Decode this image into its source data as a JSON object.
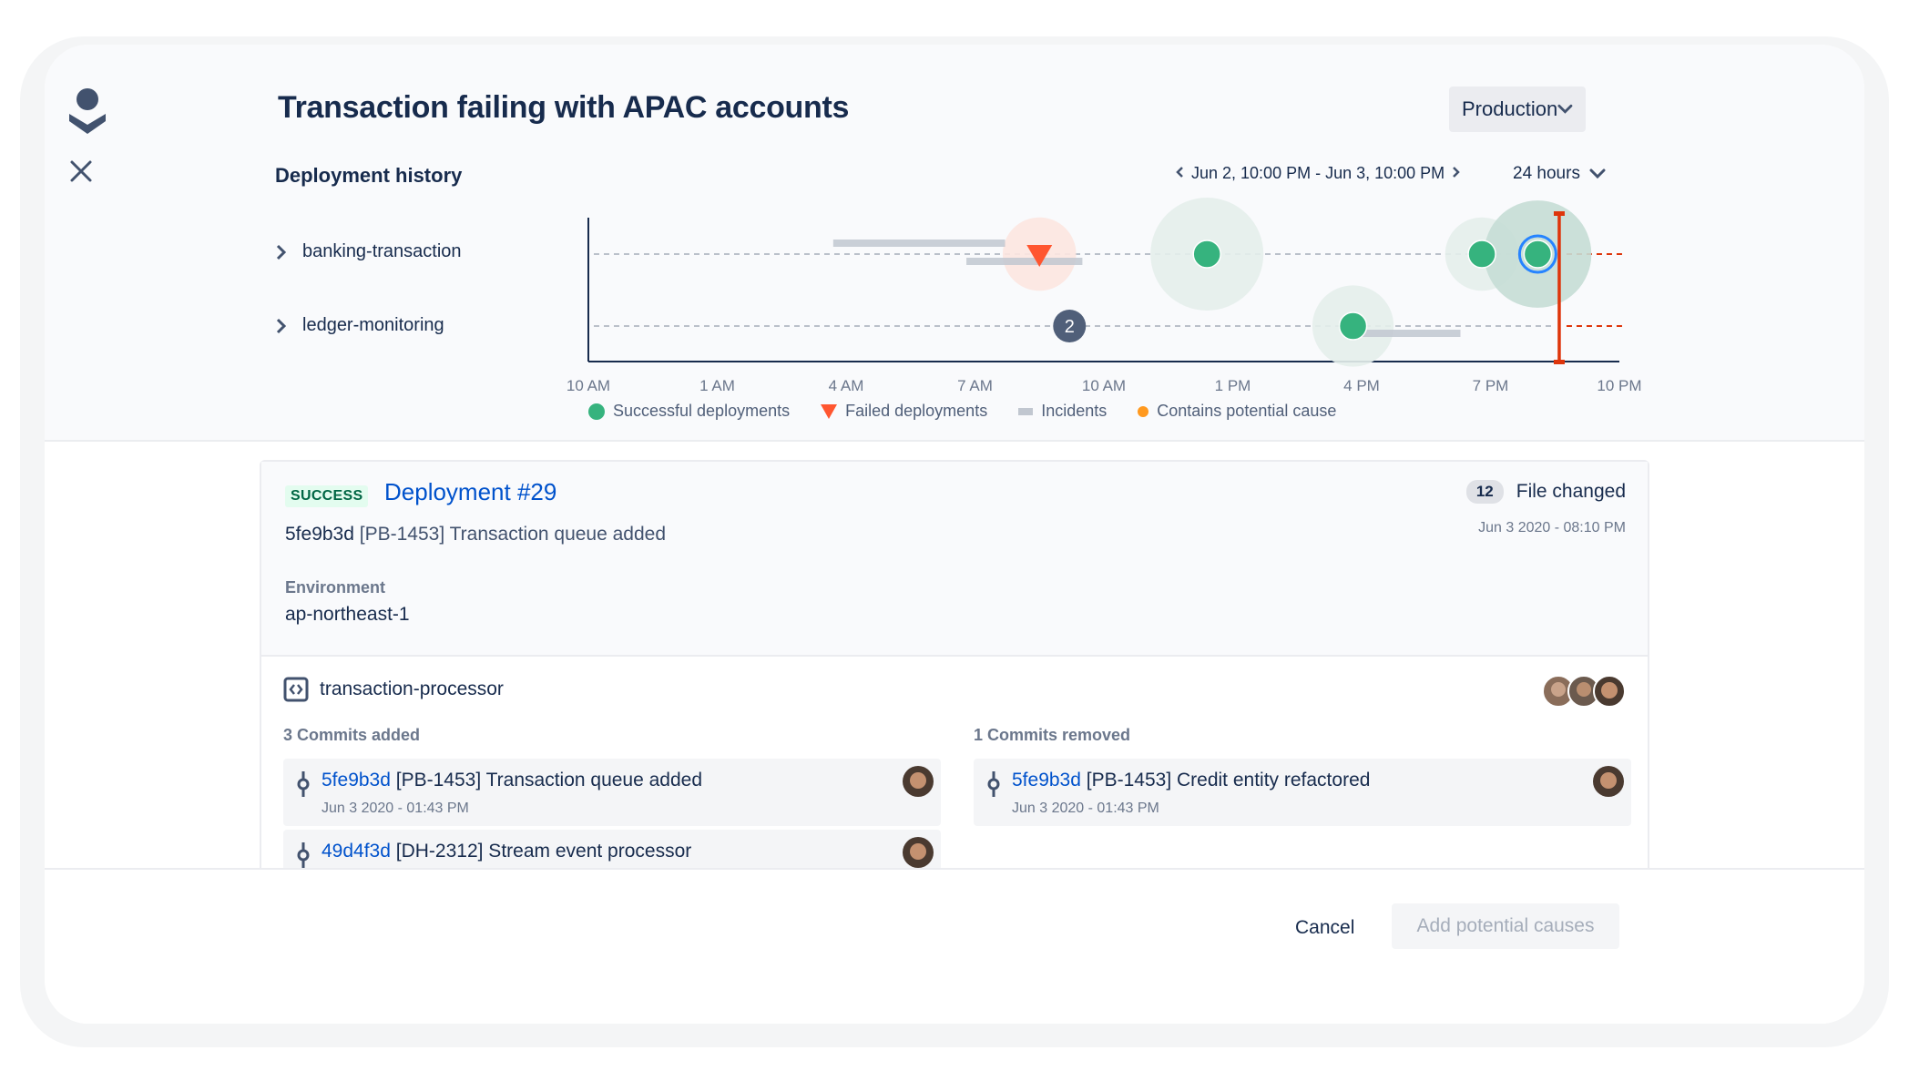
{
  "header": {
    "title": "Transaction failing with APAC accounts",
    "environment_select": {
      "selected": "Production"
    }
  },
  "deployment_history": {
    "label": "Deployment history",
    "date_range": "Jun 2, 10:00 PM - Jun 3, 10:00 PM",
    "window": "24 hours",
    "services": [
      {
        "name": "banking-transaction"
      },
      {
        "name": "ledger-monitoring"
      }
    ]
  },
  "colors": {
    "success": "#36B37E",
    "failed": "#FF5630",
    "incident": "#C1C7D0",
    "potential_cause": "#FF991F",
    "selected_ring": "#2684FF",
    "marker": "#DE350B",
    "cluster": "#505F79"
  },
  "chart_data": {
    "type": "scatter",
    "title": "Deployment history",
    "xlabel": "",
    "ylabel": "",
    "x_range_hours": [
      0,
      24
    ],
    "x_ticks": [
      "10 AM",
      "1 AM",
      "4 AM",
      "7 AM",
      "10 AM",
      "1 PM",
      "4 PM",
      "7 PM",
      "10 PM"
    ],
    "rows": [
      "banking-transaction",
      "ledger-monitoring"
    ],
    "legend": [
      {
        "label": "Successful deployments",
        "symbol": "circle",
        "color": "#36B37E"
      },
      {
        "label": "Failed deployments",
        "symbol": "triangle-down",
        "color": "#FF5630"
      },
      {
        "label": "Incidents",
        "symbol": "bar",
        "color": "#C1C7D0"
      },
      {
        "label": "Contains potential cause",
        "symbol": "dot",
        "color": "#FF991F"
      }
    ],
    "legend_position": "bottom",
    "incidents": [
      {
        "row": 0,
        "start": 5.7,
        "end": 9.7,
        "lane": "upper"
      },
      {
        "row": 0,
        "start": 8.8,
        "end": 11.5,
        "lane": "lower"
      },
      {
        "row": 1,
        "start": 17.6,
        "end": 20.3,
        "lane": "lower"
      }
    ],
    "deployments": [
      {
        "row": 0,
        "x": 10.5,
        "status": "failed",
        "halo": 0.65
      },
      {
        "row": 0,
        "x": 14.4,
        "status": "success",
        "halo": 1.0
      },
      {
        "row": 0,
        "x": 20.8,
        "status": "success",
        "halo": 0.65
      },
      {
        "row": 0,
        "x": 22.1,
        "status": "success",
        "halo": 0.95,
        "selected": true
      },
      {
        "row": 1,
        "x": 11.2,
        "status": "cluster",
        "count": "2"
      },
      {
        "row": 1,
        "x": 17.8,
        "status": "success",
        "halo": 0.72
      }
    ],
    "marker_x": 22.6
  },
  "deployment": {
    "status": "SUCCESS",
    "title": "Deployment #29",
    "commit_hash": "5fe9b3d",
    "commit_message": "[PB-1453] Transaction queue added",
    "environment_label": "Environment",
    "environment_value": "ap-northeast-1",
    "files_changed_count": "12",
    "files_changed_label": "File changed",
    "date": "Jun 3 2020 - 08:10 PM",
    "repository": "transaction-processor",
    "commits_added_label": "3 Commits added",
    "commits_removed_label": "1 Commits removed",
    "commits_added": [
      {
        "hash": "5fe9b3d",
        "message": "[PB-1453] Transaction queue added",
        "date": "Jun 3 2020 - 01:43 PM"
      },
      {
        "hash": "49d4f3d",
        "message": "[DH-2312] Stream event processor",
        "date": ""
      }
    ],
    "commits_removed": [
      {
        "hash": "5fe9b3d",
        "message": "[PB-1453] Credit entity refactored",
        "date": "Jun 3 2020 - 01:43 PM"
      }
    ]
  },
  "footer": {
    "cancel_label": "Cancel",
    "add_label": "Add potential causes"
  }
}
